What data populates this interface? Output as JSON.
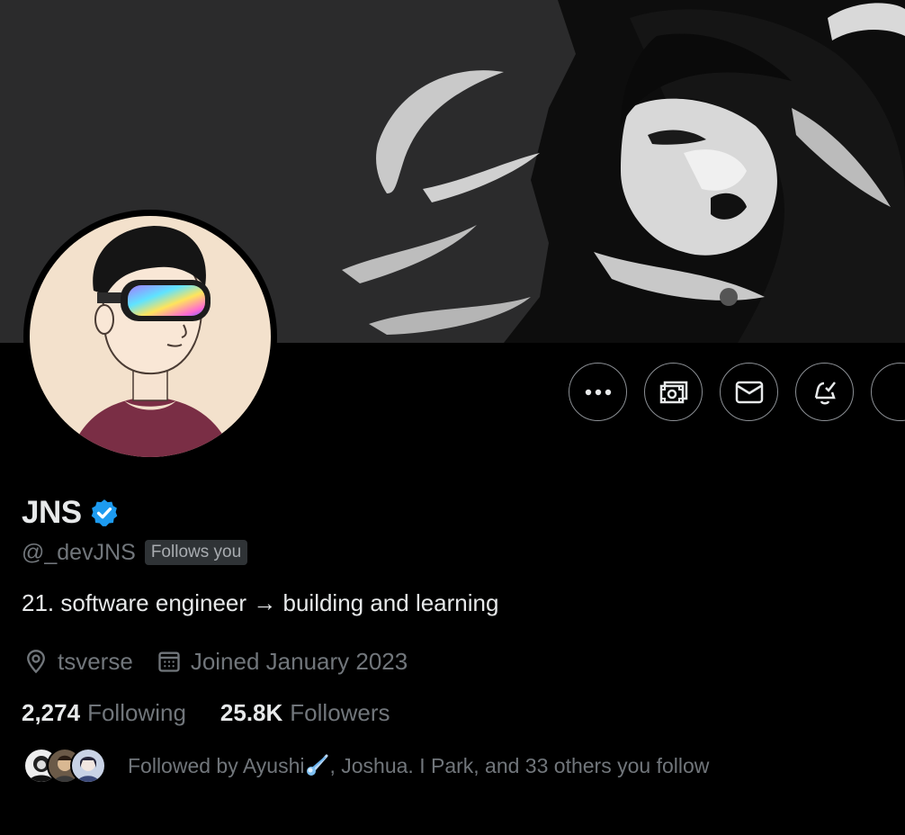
{
  "profile": {
    "display_name": "JNS",
    "verified_icon": "verified-badge-icon",
    "handle": "@_devJNS",
    "follows_you_label": "Follows you",
    "bio": "21. software engineer → building and learning",
    "location": "tsverse",
    "joined": "Joined January 2023"
  },
  "stats": {
    "following_count": "2,274",
    "following_label": "Following",
    "followers_count": "25.8K",
    "followers_label": "Followers"
  },
  "followed_by": {
    "prefix": "Followed by Ayushi",
    "emoji_icon": "comet-icon",
    "suffix": ", Joshua. I Park, and 33 others you follow"
  },
  "actions": [
    {
      "name": "more-button",
      "icon": "more-dots-icon"
    },
    {
      "name": "tip-button",
      "icon": "money-icon"
    },
    {
      "name": "message-button",
      "icon": "mail-icon"
    },
    {
      "name": "notifications-button",
      "icon": "bell-check-icon"
    },
    {
      "name": "follow-button",
      "icon": "partial-button"
    }
  ],
  "colors": {
    "background": "#000000",
    "primary_text": "#e7e9ea",
    "secondary_text": "#71767b",
    "verified_blue": "#1d9bf0",
    "border": "#8b8f94"
  }
}
